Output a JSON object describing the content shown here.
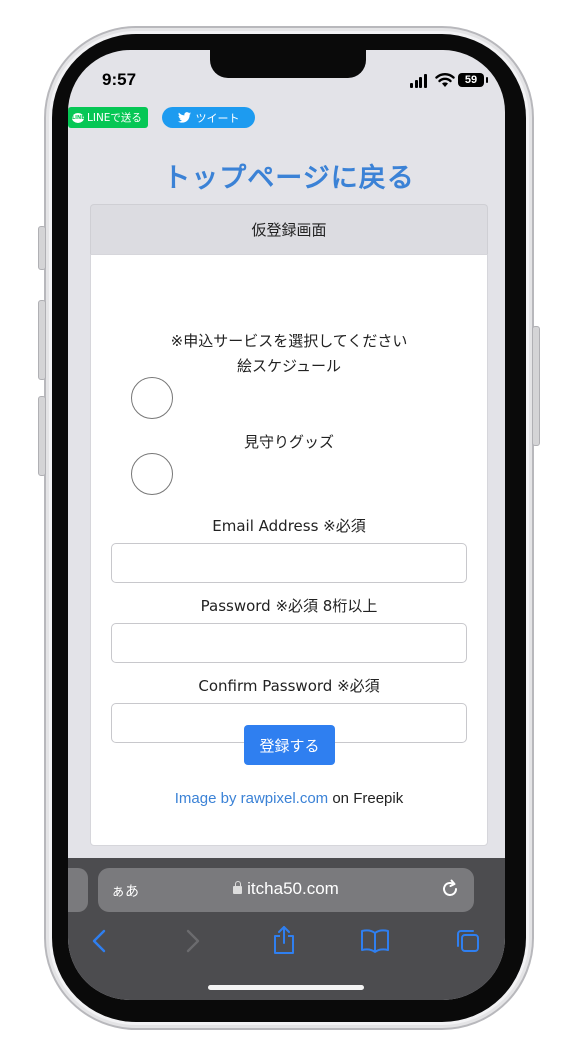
{
  "status_bar": {
    "time": "9:57",
    "battery": "59"
  },
  "share": {
    "line_label": "LINEで送る",
    "tweet_label": "ツイート"
  },
  "page": {
    "top_link": "トップページに戻る"
  },
  "card": {
    "title": "仮登録画面",
    "service_prompt": "※申込サービスを選択してください",
    "options": [
      {
        "label": "絵スケジュール",
        "checked": false
      },
      {
        "label": "見守りグッズ",
        "checked": false
      }
    ],
    "fields": [
      {
        "label": "Email Address ※必須",
        "value": "",
        "placeholder": ""
      },
      {
        "label": "Password ※必須 8桁以上",
        "value": "",
        "placeholder": ""
      },
      {
        "label": "Confirm Password ※必須",
        "value": "",
        "placeholder": ""
      }
    ],
    "submit_label": "登録する",
    "credit": {
      "link_text": "Image by rawpixel.com",
      "suffix": " on Freepik"
    }
  },
  "browser": {
    "text_size_label": "ぁあ",
    "url": "itcha50.com",
    "icons": [
      "back-icon",
      "forward-icon",
      "share-icon",
      "bookmarks-icon",
      "tabs-icon",
      "reload-icon",
      "lock-icon"
    ]
  },
  "colors": {
    "link": "#3b82d6",
    "button": "#2f7ff0",
    "line_green": "#06c755",
    "tweet_blue": "#1d9bf0",
    "toolbar": "#4c4c4f"
  }
}
